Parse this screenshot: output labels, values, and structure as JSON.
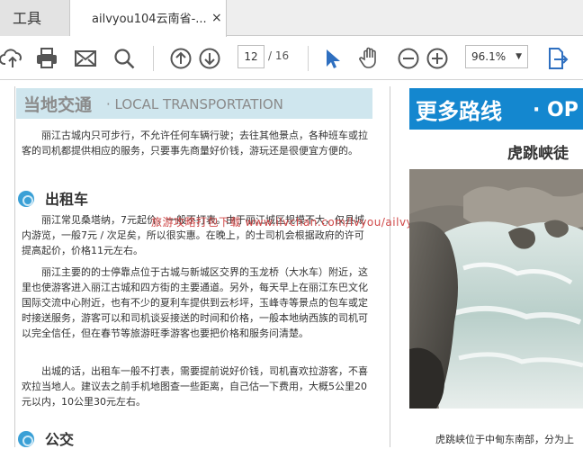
{
  "tabs": {
    "tools_label": "工具",
    "doc_label": "ailvyou104云南省-...",
    "close_icon": "×"
  },
  "toolbar": {
    "icons": [
      "cloud-upload-icon",
      "print-icon",
      "mail-icon",
      "search-icon",
      "arrow-up-icon",
      "arrow-down-icon",
      "select-arrow-icon",
      "hand-icon",
      "zoom-out-icon",
      "zoom-in-icon",
      "fit-page-icon"
    ],
    "page_current": "12",
    "page_total": "/ 16",
    "zoom_value": "96.1%"
  },
  "left_page": {
    "section_title_cn": "当地交通",
    "section_title_en": "· LOCAL TRANSPORTATION",
    "intro": "丽江古城内只可步行，不允许任何车辆行驶；去往其他景点，各种班车或拉客的司机都提供相应的服务，只要事先商量好价钱，游玩还是很便宜方便的。",
    "taxi_heading": "出租车",
    "taxi_p1": "丽江常见桑塔纳，7元起价，一般不打表。由于丽江城区规模不大，仅县城内游览，一般7元 / 次足矣，所以很实惠。在晚上，的士司机会根据政府的许可提高起价，价格11元左右。",
    "taxi_p2": "丽江主要的的士停靠点位于古城与新城区交界的玉龙桥（大水车）附近，这里也使游客进入丽江古城和四方街的主要通道。另外，每天早上在丽江东巴文化国际交流中心附近，也有不少的夏利车提供到云杉坪，玉峰寺等景点的包车或定时接送服务，游客可以和司机谈妥接送的时间和价格，一般本地纳西族的司机可以完全信任，但在春节等旅游旺季游客也要把价格和服务问清楚。",
    "taxi_p3": "出城的话，出租车一般不打表，需要提前说好价钱，司机喜欢拉游客，不喜欢拉当地人。建议去之前手机地图查一些距离，自己估一下费用，大概5公里20元以内，10公里30元左右。",
    "bus_heading": "公交",
    "watermark": "旅游攻略打包下载 www.ilvchan.com/lvyou/ailvyou"
  },
  "right_page": {
    "banner_cn": "更多路线",
    "banner_en": "· OP",
    "subtitle": "虎跳峡徒",
    "caption": "虎跳峡位于中甸东南部，分为上"
  }
}
